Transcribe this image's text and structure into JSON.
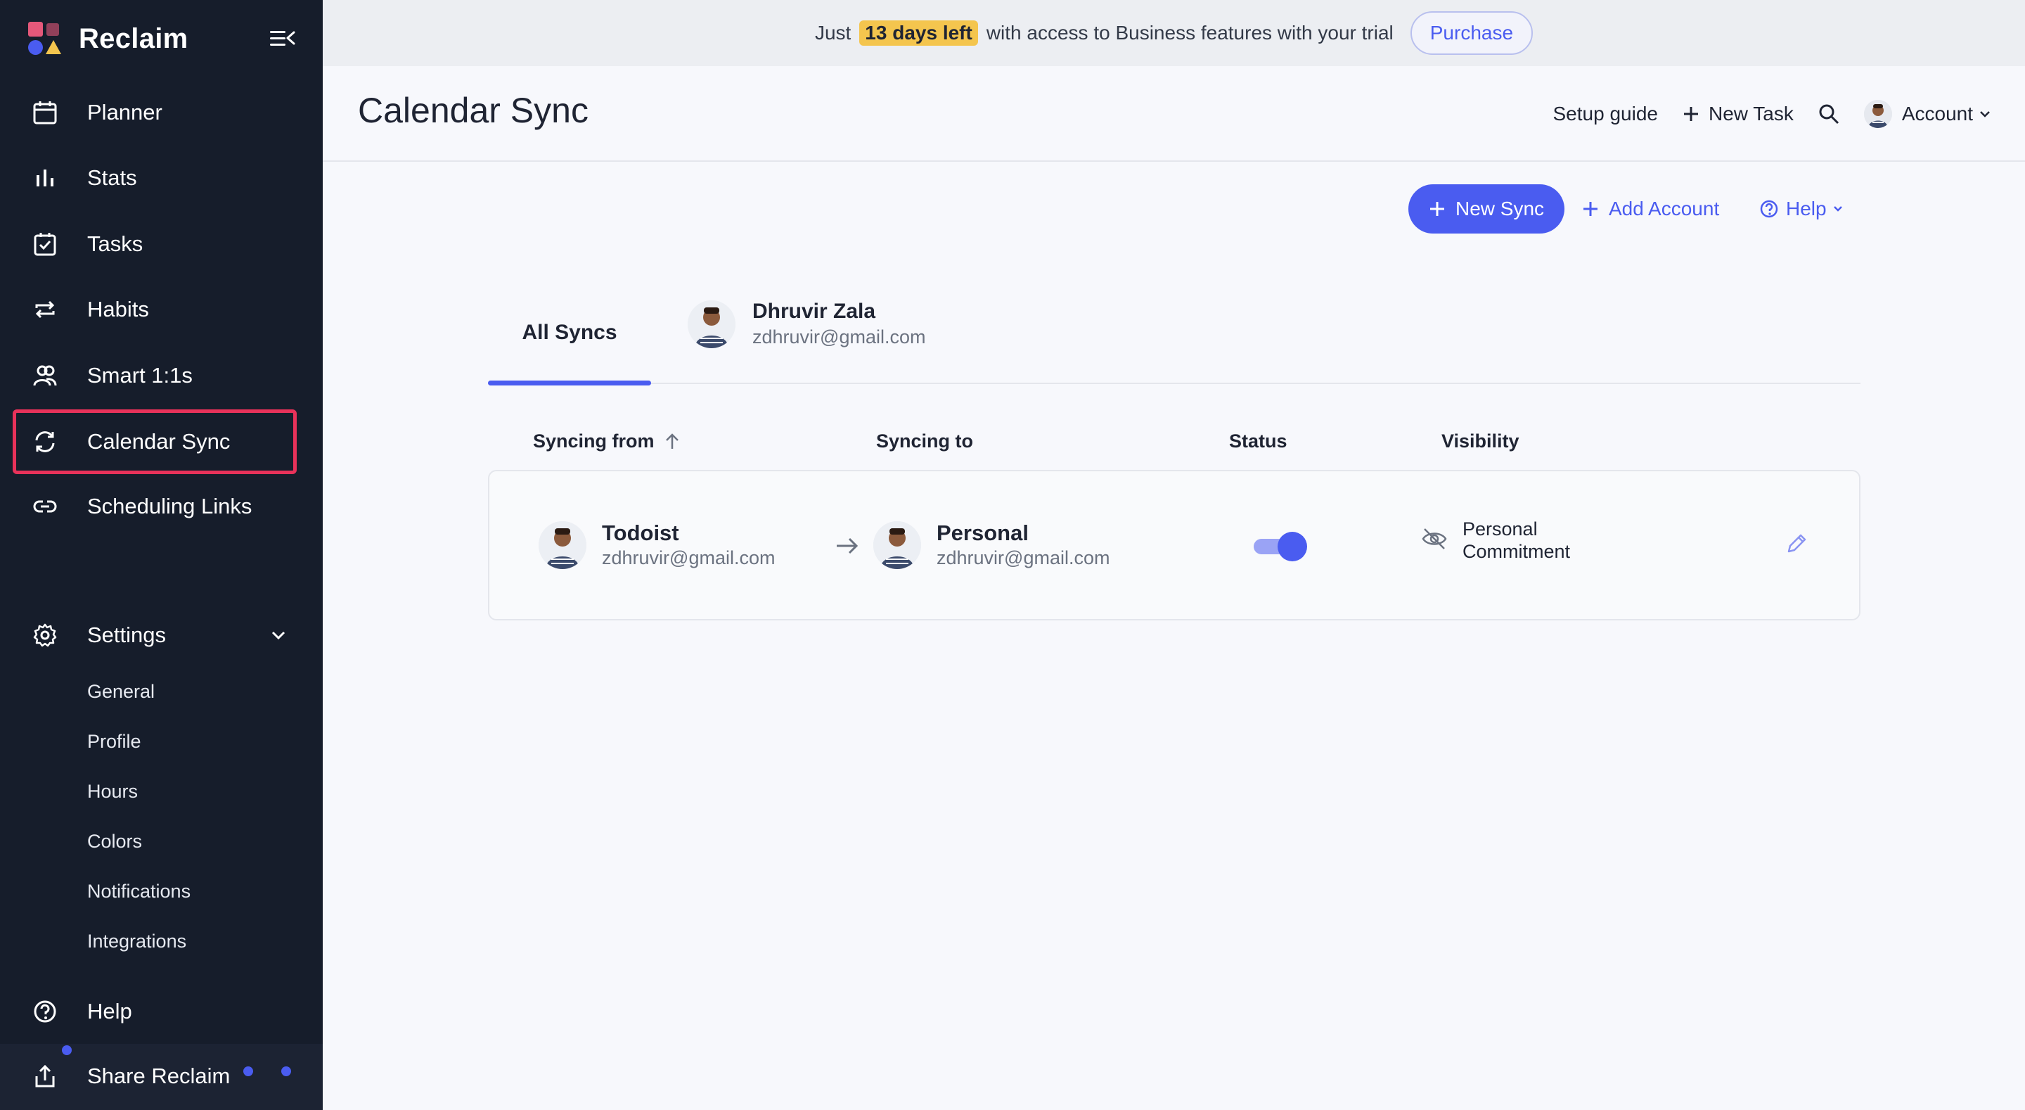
{
  "sidebar": {
    "brand": "Reclaim",
    "nav": [
      {
        "label": "Planner",
        "icon": "calendar-icon"
      },
      {
        "label": "Stats",
        "icon": "bar-chart-icon"
      },
      {
        "label": "Tasks",
        "icon": "checkbox-icon"
      },
      {
        "label": "Habits",
        "icon": "repeat-icon"
      },
      {
        "label": "Smart 1:1s",
        "icon": "people-icon"
      },
      {
        "label": "Calendar Sync",
        "icon": "sync-icon",
        "active": true
      },
      {
        "label": "Scheduling Links",
        "icon": "link-icon"
      }
    ],
    "settings": {
      "label": "Settings",
      "items": [
        "General",
        "Profile",
        "Hours",
        "Colors",
        "Notifications",
        "Integrations"
      ]
    },
    "help": "Help",
    "share": "Share Reclaim"
  },
  "banner": {
    "pre": "Just",
    "highlight": "13 days left",
    "post": "with access to Business features with your trial",
    "purchase": "Purchase"
  },
  "header": {
    "title": "Calendar Sync",
    "setup_guide": "Setup guide",
    "new_task": "New Task",
    "account": "Account"
  },
  "actions": {
    "new_sync": "New Sync",
    "add_account": "Add Account",
    "help": "Help"
  },
  "tabs": {
    "all": "All Syncs",
    "user_name": "Dhruvir Zala",
    "user_email": "zdhruvir@gmail.com"
  },
  "table": {
    "headers": {
      "from": "Syncing from",
      "to": "Syncing to",
      "status": "Status",
      "visibility": "Visibility"
    },
    "rows": [
      {
        "from_name": "Todoist",
        "from_email": "zdhruvir@gmail.com",
        "to_name": "Personal",
        "to_email": "zdhruvir@gmail.com",
        "status_on": true,
        "visibility_line1": "Personal",
        "visibility_line2": "Commitment"
      }
    ]
  },
  "colors": {
    "accent": "#4a5cf0",
    "sidebar_bg": "#161d2b",
    "highlight": "#f4c54e",
    "active_outline": "#e8325a"
  }
}
